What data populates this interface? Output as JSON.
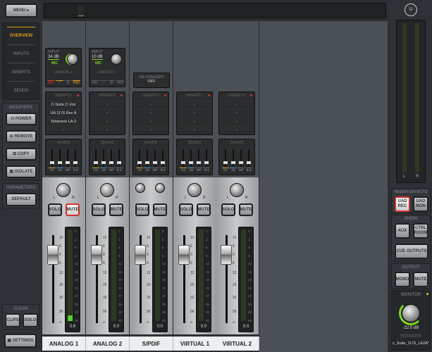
{
  "sidebar": {
    "menu": "MENU",
    "views": [
      "OVERVIEW",
      "INPUTS",
      "INSERTS",
      "SENDS"
    ],
    "active_view": "OVERVIEW",
    "modifiers_label": "MODIFIERS",
    "modifiers": [
      "POWER",
      "REMOVE",
      "COPY",
      "ISOLATE"
    ],
    "parameters_label": "PARAMETERS",
    "default": "DEFAULT",
    "clear_label": "CLEAR",
    "clear": [
      "CLIPS",
      "SOLO"
    ],
    "settings": "SETTINGS"
  },
  "channels": [
    {
      "name": "ANALOG 1",
      "input": {
        "label": "INPUT",
        "gain": "34 dB",
        "type": "MIC",
        "unison": "UNISON +",
        "toggles": [
          "48V",
          "",
          "Ø",
          "PAD"
        ],
        "active": [
          true,
          true,
          false,
          true
        ]
      },
      "inserts": [
        "C-Suite C-Vox",
        "UA 1176 Rev A",
        "Teletronix LA-2",
        "+"
      ],
      "sends": [
        "A1",
        "A2",
        "HP",
        "3-4"
      ],
      "solo": "SOLO",
      "mute": "MUTE",
      "mute_on": true,
      "value": "0.6",
      "stereo": false,
      "meter": 0.06
    },
    {
      "name": "ANALOG 2",
      "input": {
        "label": "INPUT",
        "gain": "10 dB",
        "type": "MIC",
        "unison": "UNISON +",
        "toggles": [
          "48V",
          "",
          "Ø",
          "PAD"
        ],
        "active": [
          false,
          false,
          false,
          false
        ]
      },
      "inserts": [
        "+",
        "+",
        "+",
        "+"
      ],
      "sends": [
        "A1",
        "A2",
        "HP",
        "3-4"
      ],
      "solo": "SOLO",
      "mute": "MUTE",
      "mute_on": false,
      "value": "0.0",
      "stereo": false,
      "meter": 0
    },
    {
      "name": "S/PDIF",
      "sr_convert": {
        "label": "SR CONVERT",
        "value": "OFF"
      },
      "inserts": [
        "+",
        "+",
        "+",
        "+"
      ],
      "sends": [
        "A1",
        "A2",
        "HP",
        "3-4"
      ],
      "solo": "SOLO",
      "mute": "MUTE",
      "mute_on": false,
      "value": "0.0",
      "stereo": true,
      "meter": 0
    },
    {
      "name": "VIRTUAL 1",
      "inserts": [
        "+",
        "+",
        "+",
        "+"
      ],
      "sends": [
        "A1",
        "A2",
        "HP",
        "3-4"
      ],
      "solo": "SOLO",
      "mute": "MUTE",
      "mute_on": false,
      "value": "0.0",
      "stereo": false,
      "meter": 0
    },
    {
      "name": "VIRTUAL 2",
      "inserts": [
        "+",
        "+",
        "+",
        "+"
      ],
      "sends": [
        "A1",
        "A2",
        "HP",
        "3-4"
      ],
      "solo": "SOLO",
      "mute": "MUTE",
      "mute_on": false,
      "value": "0.0",
      "stereo": false,
      "meter": 0
    }
  ],
  "inserts_label": "INSERTS",
  "sends_label": "SENDS",
  "pan_labels": [
    "L",
    "R"
  ],
  "fader_scale": [
    "12",
    "6",
    "0",
    "6",
    "12",
    "20",
    "32",
    "56",
    "∞"
  ],
  "meter_scale": [
    "0",
    "3",
    "6",
    "9",
    "12",
    "15",
    "18",
    "21",
    "27",
    "36",
    "48",
    "60"
  ],
  "right": {
    "meter_labels": [
      "L",
      "R"
    ],
    "insert_effects_label": "INSERT EFFECTS",
    "uad_rec": "UAD REC",
    "uad_mon": "UAD MON",
    "show_label": "SHOW",
    "aux": "AUX",
    "ctrl_room": "CTRL ROOM",
    "cue_outputs": "CUE OUTPUTS",
    "output_label": "OUTPUT",
    "mono": "MONO",
    "mute": "MUTE",
    "monitor_label": "MONITOR",
    "monitor_value": "-22.0 dB",
    "sessions_label": "SESSIONS",
    "session_name": "c_Suite_1176_LA2A*"
  },
  "colors": {
    "accent": "#e0a020",
    "green": "#7ed321",
    "red": "#d0302a"
  }
}
